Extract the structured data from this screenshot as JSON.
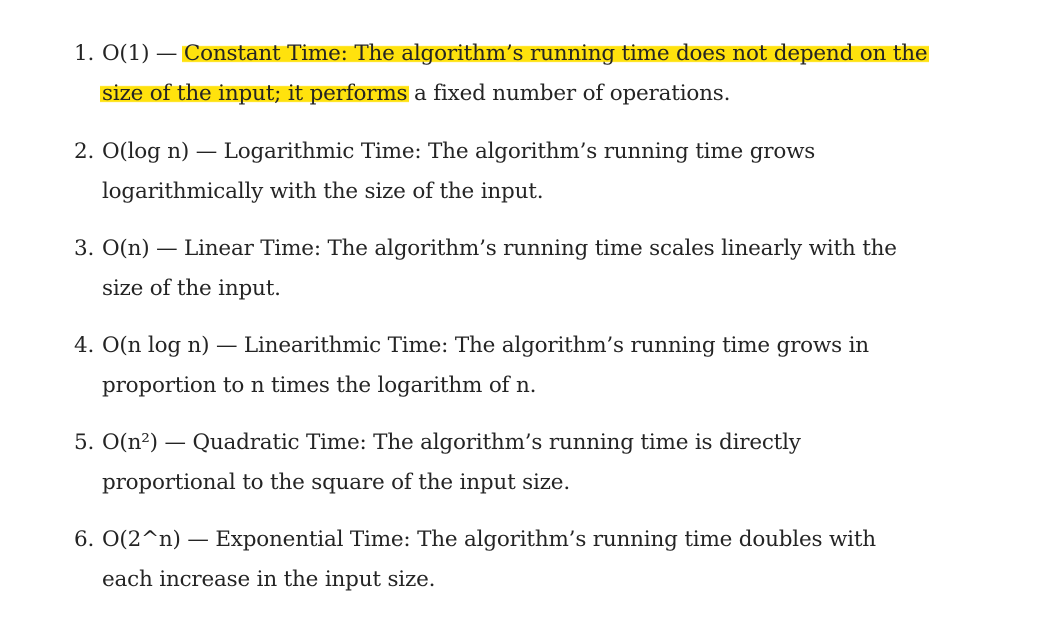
{
  "list": {
    "items": [
      {
        "number": "1.",
        "lead": "O(1) — ",
        "highlighted": "Constant Time: The algorithm’s running time does not depend on the size of the input; it performs",
        "rest": " a fixed number of operations."
      },
      {
        "number": "2.",
        "lead": "O(log n) — ",
        "highlighted": "",
        "rest": "Logarithmic Time: The algorithm’s running time grows logarithmically with the size of the input."
      },
      {
        "number": "3.",
        "lead": "O(n) — ",
        "highlighted": "",
        "rest": "Linear Time: The algorithm’s running time scales linearly with the size of the input."
      },
      {
        "number": "4.",
        "lead": "O(n log n) — ",
        "highlighted": "",
        "rest": "Linearithmic Time: The algorithm’s running time grows in proportion to n times the logarithm of n."
      },
      {
        "number": "5.",
        "lead": "O(n²) — ",
        "highlighted": "",
        "rest": "Quadratic Time: The algorithm’s running time is directly proportional to the square of the input size."
      },
      {
        "number": "6.",
        "lead": "O(2^n) — ",
        "highlighted": "",
        "rest": "Exponential Time: The algorithm’s running time doubles with each increase in the input size."
      }
    ]
  },
  "colors": {
    "text": "#242424",
    "highlight": "#ffe000"
  }
}
